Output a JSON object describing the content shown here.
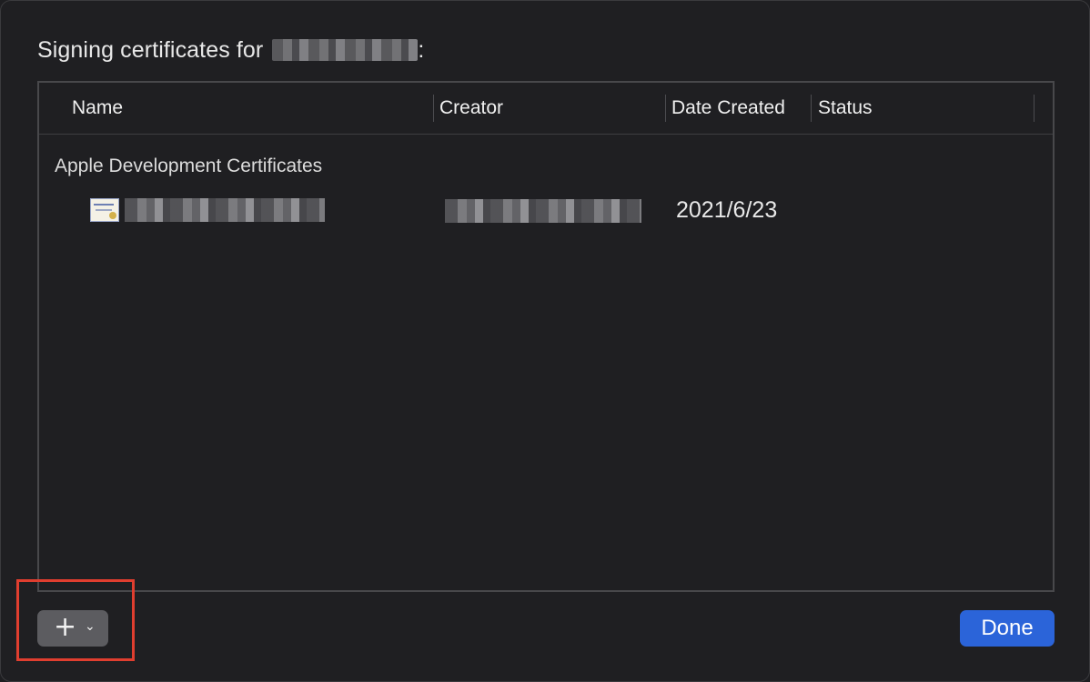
{
  "dialog": {
    "title_prefix": "Signing certificates for",
    "title_suffix": ":"
  },
  "table": {
    "columns": [
      "Name",
      "Creator",
      "Date Created",
      "Status"
    ],
    "group_label": "Apple Development Certificates",
    "rows": [
      {
        "date_created": "2021/6/23",
        "status": ""
      }
    ]
  },
  "footer": {
    "add_button_icon": "plus-icon",
    "add_button_menu_icon": "chevron-down-icon",
    "done_label": "Done"
  },
  "colors": {
    "background": "#1f1f22",
    "accent": "#2b64d9",
    "highlight": "#e03e2f"
  }
}
